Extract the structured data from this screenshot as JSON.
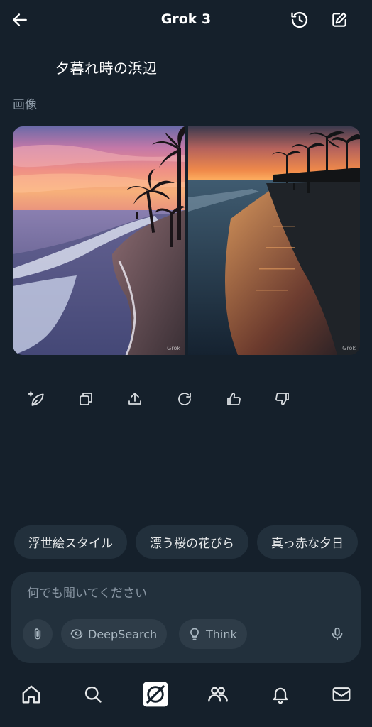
{
  "header": {
    "title": "Grok 3",
    "back_icon": "arrow-left-icon",
    "history_icon": "history-icon",
    "compose_icon": "compose-icon"
  },
  "conversation": {
    "user_message": "夕暮れ時の浜辺",
    "section_label": "画像",
    "images": [
      {
        "alt": "sunset beach with palms and waves",
        "watermark": "Grok"
      },
      {
        "alt": "sunset shoreline with palms and people",
        "watermark": "Grok"
      }
    ],
    "actions": [
      "regenerate-leaf-icon",
      "copy-icon",
      "share-icon",
      "refresh-icon",
      "thumbs-up-icon",
      "thumbs-down-icon"
    ]
  },
  "suggestions": [
    "浮世絵スタイル",
    "漂う桜の花びら",
    "真っ赤な夕日"
  ],
  "composer": {
    "placeholder": "何でも聞いてください",
    "deepsearch_label": "DeepSearch",
    "think_label": "Think"
  },
  "bottom_nav": [
    "home-icon",
    "search-icon",
    "grok-icon",
    "communities-icon",
    "notifications-icon",
    "messages-icon"
  ],
  "colors": {
    "background": "#15202b",
    "surface": "#22303c",
    "pill": "#2e3c48",
    "text": "#e7e9ea",
    "muted": "#8b98a5"
  }
}
